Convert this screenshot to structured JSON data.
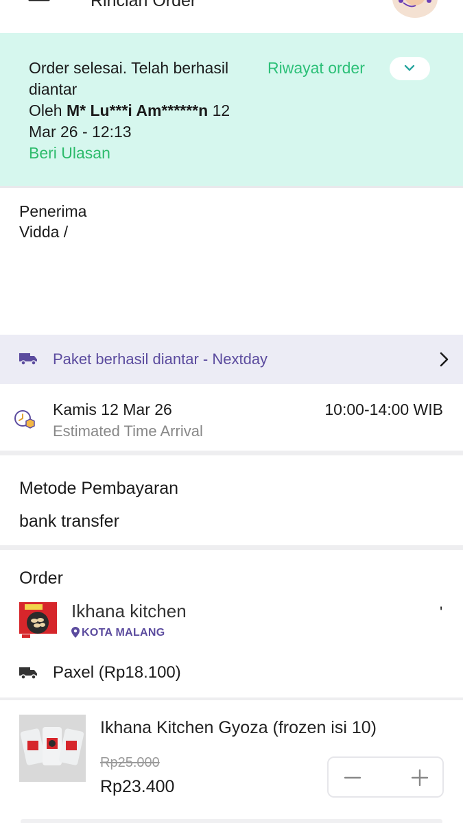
{
  "header": {
    "title": "Rincian Order"
  },
  "status": {
    "line1": "Order selesai. Telah berhasil diantar",
    "by_prefix": "Oleh",
    "courier_name": "M* Lu***i Am******n",
    "datetime": "12 Mar 26 - 12:13",
    "review_link": "Beri Ulasan",
    "history_label": "Riwayat order"
  },
  "recipient": {
    "label": "Penerima",
    "name": "Vidda /"
  },
  "delivery": {
    "status_text": "Paket berhasil diantar - Nextday"
  },
  "eta": {
    "date": "Kamis 12 Mar 26",
    "label": "Estimated Time Arrival",
    "time": "10:00-14:00 WIB"
  },
  "payment": {
    "label": "Metode Pembayaran",
    "method": "bank transfer"
  },
  "order": {
    "label": "Order",
    "store_name": "Ikhana kitchen",
    "store_location": "KOTA MALANG",
    "store_mark": "'",
    "shipping": "Paxel (Rp18.100)"
  },
  "product": {
    "name": "Ikhana Kitchen Gyoza (frozen isi 10)",
    "price_original": "Rp25.000",
    "price_final": "Rp23.400"
  },
  "colors": {
    "banner_bg": "#d6f7ee",
    "accent_green": "#2dc078",
    "accent_purple": "#5b4b9e",
    "delivery_bar_bg": "#ececf5"
  },
  "icons": {
    "back": "arrow-left-icon",
    "history_toggle": "chevron-down-icon",
    "delivery": "truck-icon",
    "delivery_detail": "chevron-right-icon",
    "eta": "clock-box-icon",
    "location": "map-pin-icon",
    "shipping": "truck-icon",
    "decrease": "minus-icon",
    "increase": "plus-icon"
  }
}
